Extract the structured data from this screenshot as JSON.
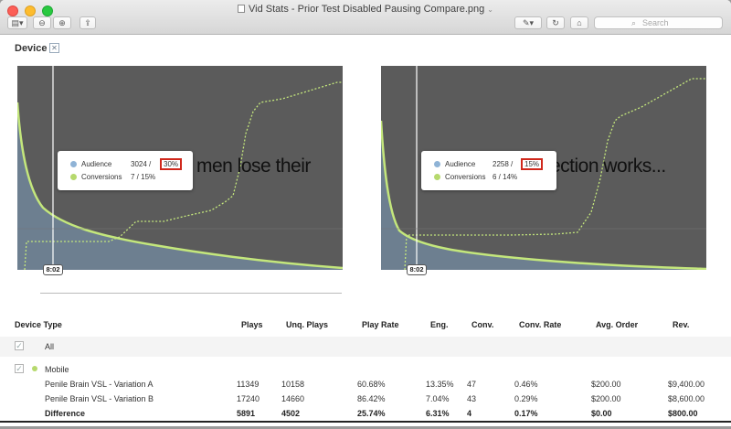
{
  "window": {
    "title": "Vid Stats - Prior Test Disabled Pausing Compare.png"
  },
  "toolbar": {
    "search_placeholder": "Search",
    "icons": [
      "sidebar-icon",
      "zoom-out-icon",
      "zoom-in-icon",
      "share-icon",
      "markup-icon",
      "rotate-icon",
      "toolbox-icon",
      "search-icon"
    ]
  },
  "section": {
    "title": "Device",
    "close_glyph": "✕"
  },
  "panels": [
    {
      "caption": "men lose their",
      "time": "8:02",
      "tooltip": {
        "audience_label": "Audience",
        "audience_count": "3024 /",
        "audience_pct": "30%",
        "conversions_label": "Conversions",
        "conversions_value": "7 / 15%"
      }
    },
    {
      "caption": "ection works...",
      "time": "8:02",
      "tooltip": {
        "audience_label": "Audience",
        "audience_count": "2258 /",
        "audience_pct": "15%",
        "conversions_label": "Conversions",
        "conversions_value": "6 / 14%"
      }
    }
  ],
  "colors": {
    "audience": "#8fb3d6",
    "conversions": "#b6d96d",
    "chart_bg": "#5b5b5b",
    "highlight": "#d0281c"
  },
  "table": {
    "headers": [
      "Device Type",
      "Plays",
      "Unq. Plays",
      "Play Rate",
      "Eng.",
      "Conv.",
      "Conv. Rate",
      "Avg. Order",
      "Rev."
    ],
    "all_label": "All",
    "group_label": "Mobile",
    "rows": [
      {
        "name": "Penile Brain VSL - Variation A",
        "plays": "11349",
        "unq": "10158",
        "play_rate": "60.68%",
        "eng": "13.35%",
        "conv": "47",
        "conv_rate": "0.46%",
        "avg_order": "$200.00",
        "rev": "$9,400.00"
      },
      {
        "name": "Penile Brain VSL - Variation B",
        "plays": "17240",
        "unq": "14660",
        "play_rate": "86.42%",
        "eng": "7.04%",
        "conv": "43",
        "conv_rate": "0.29%",
        "avg_order": "$200.00",
        "rev": "$8,600.00"
      }
    ],
    "difference": {
      "name": "Difference",
      "plays": "5891",
      "unq": "4502",
      "play_rate": "25.74%",
      "eng": "6.31%",
      "conv": "4",
      "conv_rate": "0.17%",
      "avg_order": "$0.00",
      "rev": "$800.00"
    }
  }
}
